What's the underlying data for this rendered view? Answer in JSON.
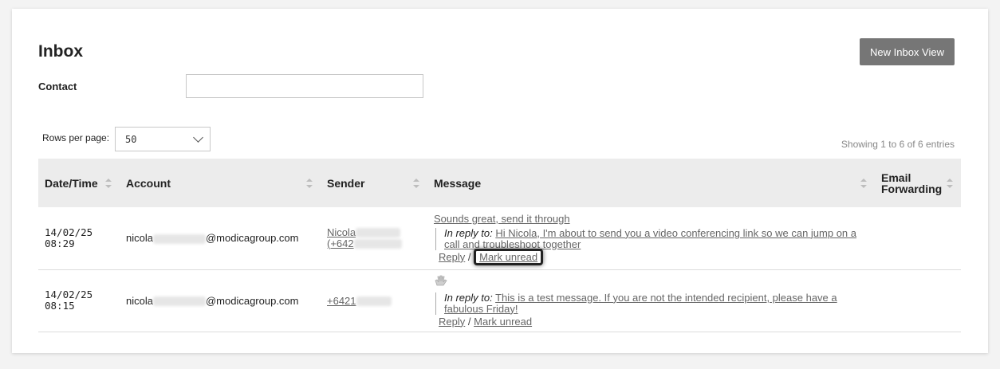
{
  "page": {
    "title": "Inbox",
    "new_view_label": "New Inbox View"
  },
  "filter": {
    "contact_label": "Contact",
    "contact_value": ""
  },
  "paging": {
    "rows_label": "Rows per page:",
    "rows_value": "50",
    "showing_text": "Showing 1 to 6 of 6 entries"
  },
  "table": {
    "headers": [
      "Date/Time",
      "Account",
      "Sender",
      "Message",
      "Email Forwarding"
    ],
    "rows": [
      {
        "date": "14/02/25",
        "time": "08:29",
        "account_prefix": "nicola",
        "account_suffix": "@modicagroup.com",
        "sender_name": "Nicola",
        "sender_number": "(+642",
        "message": "Sounds great, send it through",
        "reply_label": "In reply to:",
        "reply_text": "Hi Nicola, I'm about to send you a video conferencing link so we can jump on a call and troubleshoot together",
        "reply_action": "Reply",
        "mark_unread": "Mark unread",
        "separator": "/"
      },
      {
        "date": "14/02/25",
        "time": "08:15",
        "account_prefix": "nicola",
        "account_suffix": "@modicagroup.com",
        "sender_number": "+6421",
        "message_icon": "waving-hand-icon",
        "reply_label": "In reply to:",
        "reply_text": "This is a test message. If you are not the intended recipient, please have a fabulous Friday!",
        "reply_action": "Reply",
        "mark_unread": "Mark unread",
        "separator": "/"
      }
    ]
  }
}
